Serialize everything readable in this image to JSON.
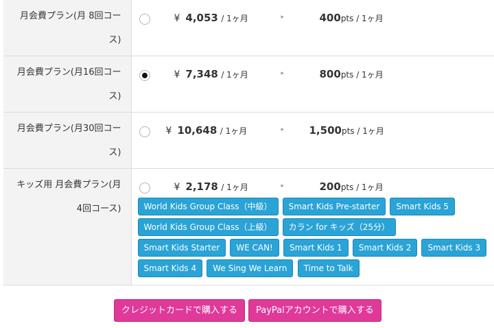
{
  "plans": [
    {
      "name_line1": "月会費プラン(月 8回コー",
      "name_line2": "ス)",
      "yen": "¥",
      "price": "4,053",
      "per": "/ 1ヶ月",
      "points": "400",
      "pts_unit": "pts / 1ヶ月",
      "selected": false
    },
    {
      "name_line1": "月会費プラン(月16回コー",
      "name_line2": "ス)",
      "yen": "¥",
      "price": "7,348",
      "per": "/ 1ヶ月",
      "points": "800",
      "pts_unit": "pts / 1ヶ月",
      "selected": true
    },
    {
      "name_line1": "月会費プラン(月30回コー",
      "name_line2": "ス)",
      "yen": "¥",
      "price": "10,648",
      "per": "/ 1ヶ月",
      "points": "1,500",
      "pts_unit": "pts / 1ヶ月",
      "selected": false
    },
    {
      "name_line1": "キッズ用 月会費プラン(月",
      "name_line2": "4回コース)",
      "yen": "¥",
      "price": "2,178",
      "per": "/ 1ヶ月",
      "points": "200",
      "pts_unit": "pts / 1ヶ月",
      "selected": false
    }
  ],
  "arrow_glyph": "▸",
  "kids_courses": [
    "World Kids Group Class（中級）",
    "Smart Kids Pre-starter",
    "Smart Kids 5",
    "World Kids Group Class（上級）",
    "カラン for キッズ（25分）",
    "Smart Kids Starter",
    "WE CAN!",
    "Smart Kids 1",
    "Smart Kids 2",
    "Smart Kids 3",
    "Smart Kids 4",
    "We Sing We Learn",
    "Time to Talk"
  ],
  "buttons": {
    "credit": "クレジットカードで購入する",
    "paypal": "PayPalアカウントで購入する"
  },
  "colors": {
    "tag": "#2aa3d6",
    "buy": "#e0399a"
  }
}
